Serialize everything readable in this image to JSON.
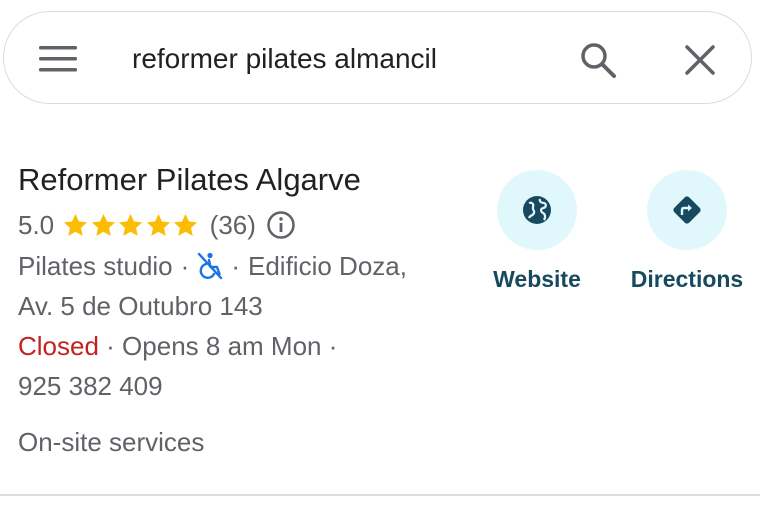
{
  "search": {
    "query": "reformer pilates almancil"
  },
  "icons": {
    "menu": "menu-icon",
    "search": "search-icon",
    "close": "close-icon",
    "info": "info-icon",
    "accessibility": "no-wheelchair-access-icon",
    "website": "globe-icon",
    "directions": "directions-icon"
  },
  "colors": {
    "star": "#fbbc04",
    "closed": "#c5221f",
    "action_bg": "#e0f7fc",
    "action_icon": "#174a5e",
    "accessibility_icon": "#1a73e8"
  },
  "result": {
    "name": "Reformer Pilates Algarve",
    "rating": "5.0",
    "stars": 5,
    "review_count": "(36)",
    "category": "Pilates studio",
    "separator": "·",
    "address_part1": "Edificio Doza,",
    "address_part2": "Av. 5 de Outubro 143",
    "status": "Closed",
    "hours": "· Opens 8 am Mon ·",
    "phone": "925 382 409",
    "services": "On-site services"
  },
  "actions": {
    "website_label": "Website",
    "directions_label": "Directions"
  }
}
